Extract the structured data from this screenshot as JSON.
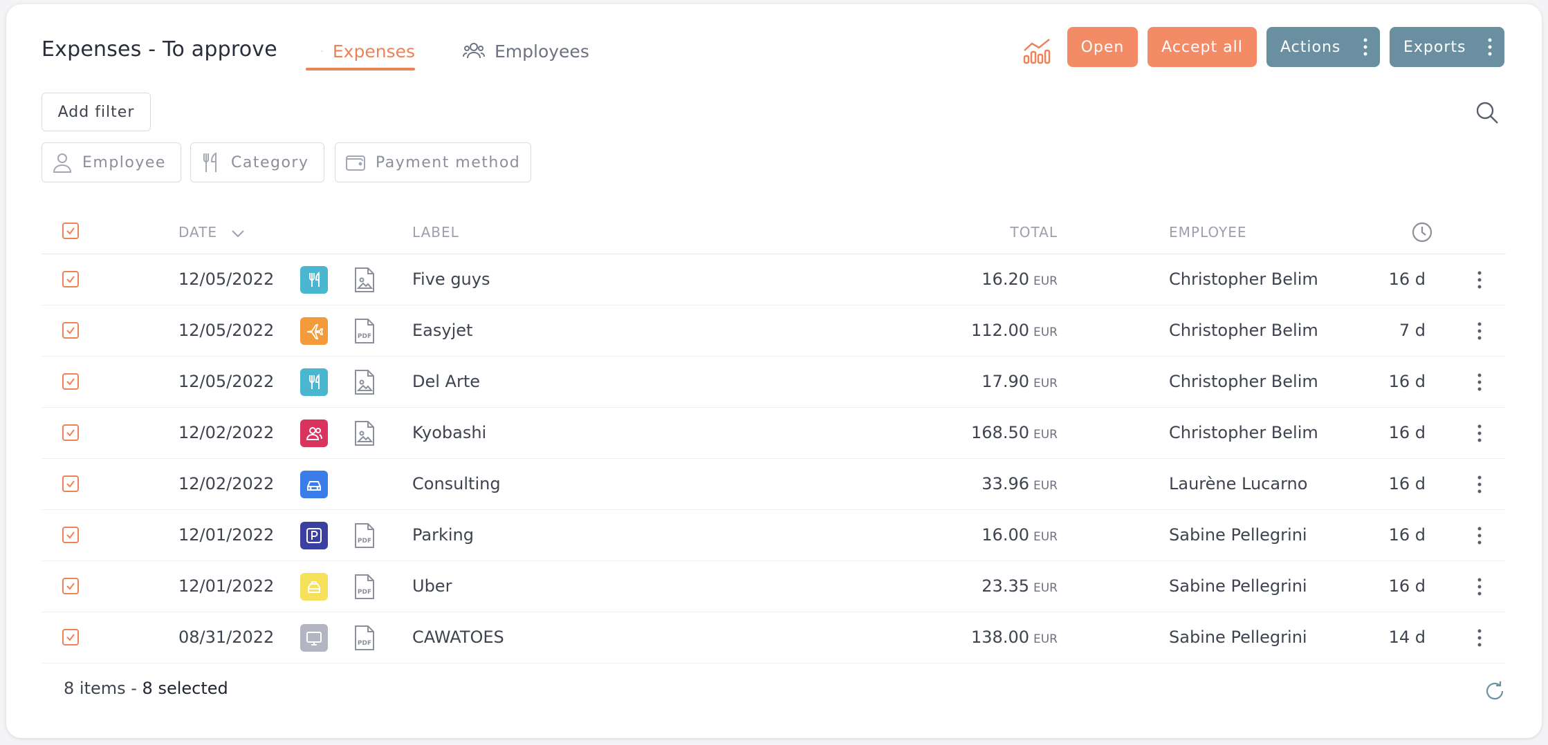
{
  "header": {
    "title": "Expenses - To approve",
    "tabs": [
      {
        "label": "Expenses",
        "icon": "copy-icon",
        "active": true
      },
      {
        "label": "Employees",
        "icon": "users-icon",
        "active": false
      }
    ],
    "buttons": {
      "open": "Open",
      "accept_all": "Accept all",
      "actions": "Actions",
      "exports": "Exports"
    }
  },
  "filters": {
    "add_filter": "Add filter",
    "chips": [
      {
        "label": "Employee",
        "icon": "user-icon"
      },
      {
        "label": "Category",
        "icon": "utensils-icon"
      },
      {
        "label": "Payment method",
        "icon": "wallet-icon"
      }
    ]
  },
  "table": {
    "columns": {
      "date": "DATE",
      "label": "LABEL",
      "total": "TOTAL",
      "employee": "EMPLOYEE"
    },
    "rows": [
      {
        "date": "12/05/2022",
        "category": "restaurant",
        "category_color": "#4ab6d0",
        "attachment": "image",
        "label": "Five guys",
        "total": "16.20",
        "currency": "EUR",
        "employee": "Christopher Belim",
        "age": "16 d"
      },
      {
        "date": "12/05/2022",
        "category": "flight",
        "category_color": "#f39a3b",
        "attachment": "pdf",
        "label": "Easyjet",
        "total": "112.00",
        "currency": "EUR",
        "employee": "Christopher Belim",
        "age": "7 d"
      },
      {
        "date": "12/05/2022",
        "category": "restaurant",
        "category_color": "#4ab6d0",
        "attachment": "image",
        "label": "Del Arte",
        "total": "17.90",
        "currency": "EUR",
        "employee": "Christopher Belim",
        "age": "16 d"
      },
      {
        "date": "12/02/2022",
        "category": "people",
        "category_color": "#d9345e",
        "attachment": "image",
        "label": "Kyobashi",
        "total": "168.50",
        "currency": "EUR",
        "employee": "Christopher Belim",
        "age": "16 d"
      },
      {
        "date": "12/02/2022",
        "category": "car",
        "category_color": "#3b7de8",
        "attachment": "none",
        "label": "Consulting",
        "total": "33.96",
        "currency": "EUR",
        "employee": "Laurène Lucarno",
        "age": "16 d"
      },
      {
        "date": "12/01/2022",
        "category": "parking",
        "category_color": "#3b3fa0",
        "attachment": "pdf",
        "label": "Parking",
        "total": "16.00",
        "currency": "EUR",
        "employee": "Sabine Pellegrini",
        "age": "16 d"
      },
      {
        "date": "12/01/2022",
        "category": "taxi",
        "category_color": "#f5e15a",
        "attachment": "pdf",
        "label": "Uber",
        "total": "23.35",
        "currency": "EUR",
        "employee": "Sabine Pellegrini",
        "age": "16 d"
      },
      {
        "date": "08/31/2022",
        "category": "computer",
        "category_color": "#b3b5c2",
        "attachment": "pdf",
        "label": "CAWATOES",
        "total": "138.00",
        "currency": "EUR",
        "employee": "Sabine Pellegrini",
        "age": "14 d"
      }
    ]
  },
  "footer": {
    "items": "8 items - ",
    "selected": "8 selected"
  },
  "colors": {
    "accent": "#ec8257",
    "primary_button": "#f28b66",
    "secondary_button": "#6a8fa0"
  }
}
